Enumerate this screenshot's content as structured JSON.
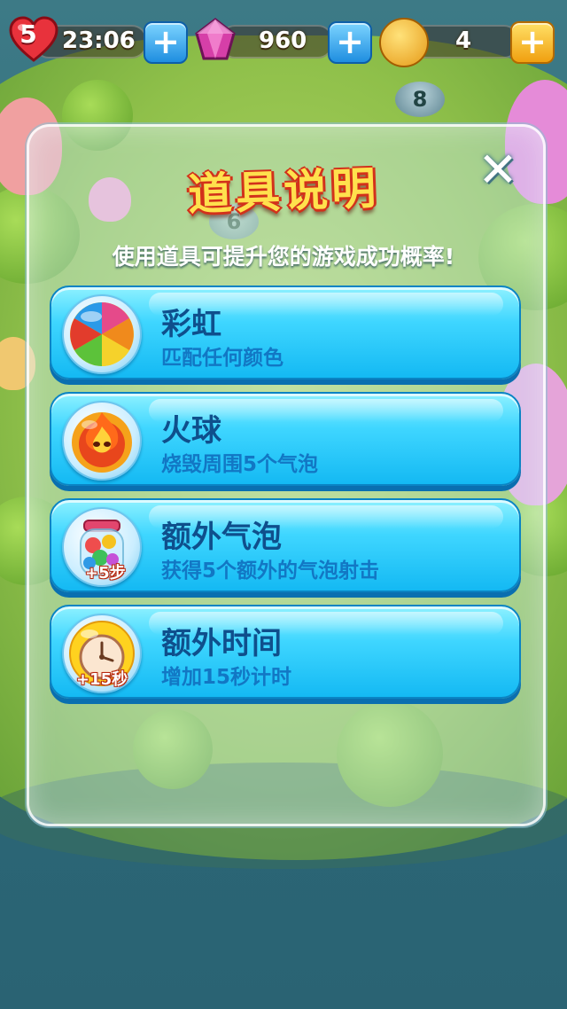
{
  "hud": {
    "lives": "5",
    "timer": "23:06",
    "gems": "960",
    "coins": "4"
  },
  "dialog": {
    "title": "道具说明",
    "close": "✕",
    "subtitle": "使用道具可提升您的游戏成功概率!",
    "items": [
      {
        "name": "彩虹",
        "desc": "匹配任何颜色"
      },
      {
        "name": "火球",
        "desc": "烧毁周围5个气泡"
      },
      {
        "name": "额外气泡",
        "desc": "获得5个额外的气泡射击",
        "badge": "+5步"
      },
      {
        "name": "额外时间",
        "desc": "增加15秒计时",
        "badge": "+15秒"
      }
    ]
  },
  "map": {
    "level_nodes": [
      "8",
      "6"
    ]
  },
  "colors": {
    "item_bg": "#3fd6ff",
    "item_name": "#0f4f8c",
    "item_desc": "#1277c4",
    "title_fill": "#ffe14d",
    "title_stroke": "#d2311b"
  },
  "icons": {
    "lives": "heart-icon",
    "gems": "gem-icon",
    "coins": "coin-icon",
    "add": "plus-icon",
    "close": "close-icon",
    "items": [
      "rainbow-ball-icon",
      "fireball-icon",
      "candy-jar-icon",
      "alarm-clock-icon"
    ]
  }
}
